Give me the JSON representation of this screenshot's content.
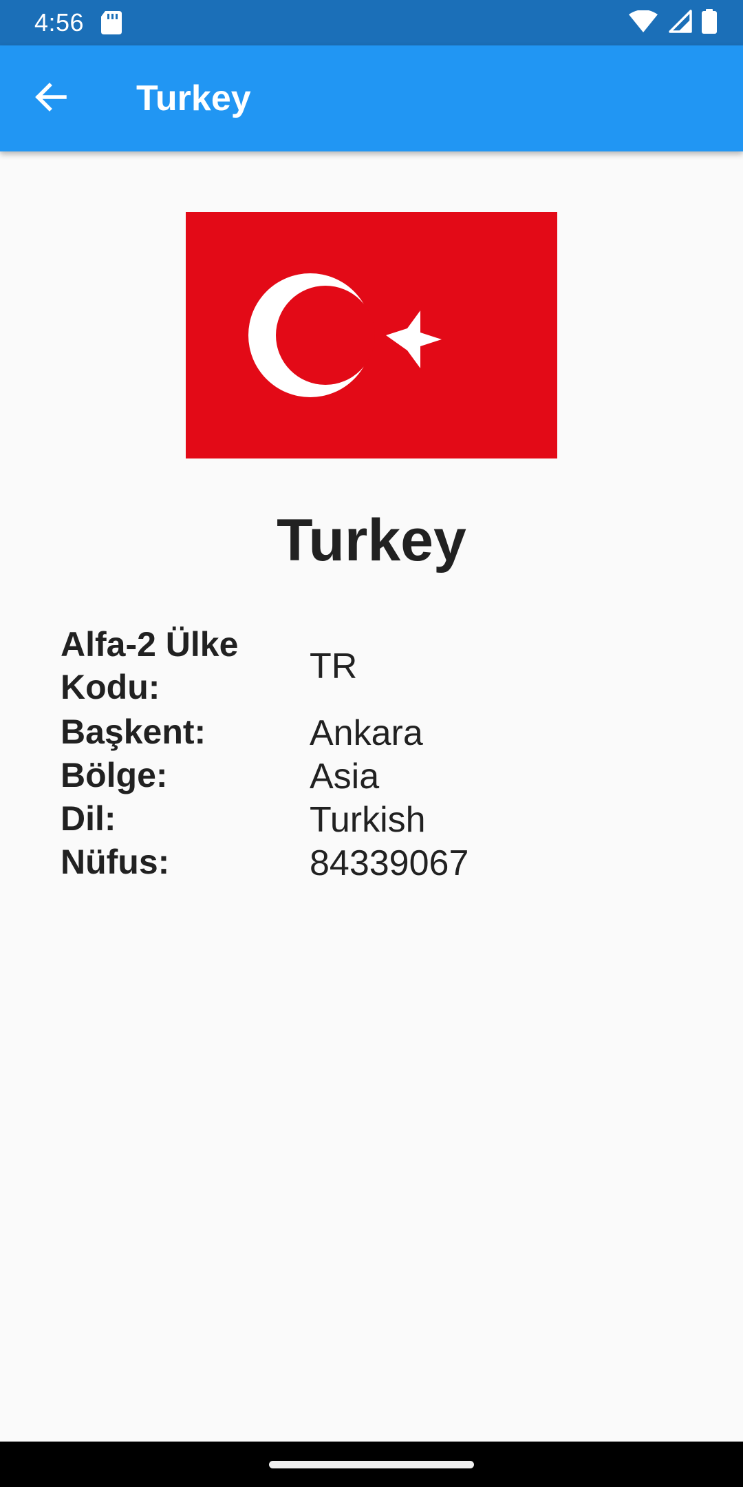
{
  "status_bar": {
    "time": "4:56",
    "icons": [
      "sd-card-icon",
      "wifi-icon",
      "signal-icon",
      "battery-icon"
    ]
  },
  "app_bar": {
    "title": "Turkey",
    "back_icon": "arrow-back-icon",
    "color": "#2196f3"
  },
  "flag": {
    "icon": "turkey-flag",
    "background": "#e30a17",
    "symbol_color": "#ffffff"
  },
  "country": {
    "name": "Turkey"
  },
  "details": [
    {
      "label": "Alfa-2 Ülke Kodu:",
      "value": "TR"
    },
    {
      "label": "Başkent:",
      "value": "Ankara"
    },
    {
      "label": "Bölge:",
      "value": "Asia"
    },
    {
      "label": "Dil:",
      "value": "Turkish"
    },
    {
      "label": "Nüfus:",
      "value": "84339067"
    }
  ]
}
